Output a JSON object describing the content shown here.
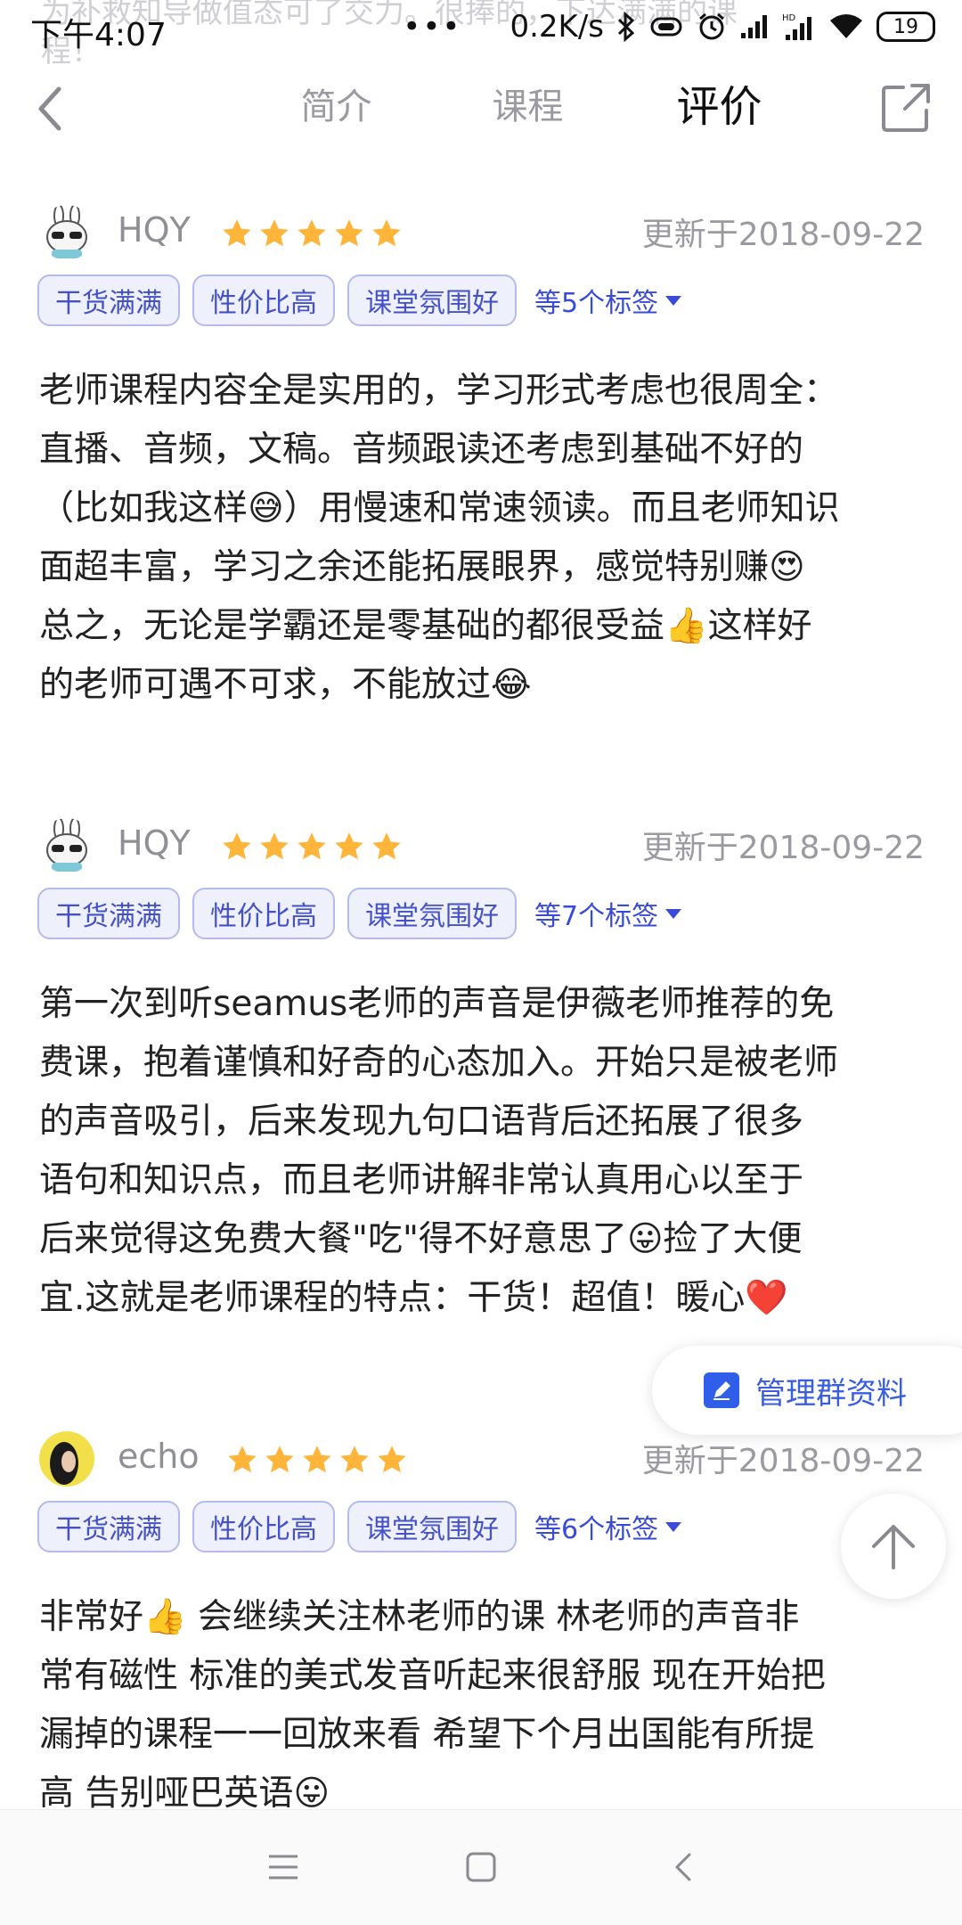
{
  "status_bar": {
    "ghost_line1": "为补救知导做值态可了交力。很捧的，下达满满的课",
    "ghost_line2": "程！",
    "time": "下午4:07",
    "dots": "•••",
    "speed": "0.2K/s",
    "battery": "19"
  },
  "nav": {
    "tabs": [
      {
        "label": "简介"
      },
      {
        "label": "课程"
      },
      {
        "label": "评价"
      }
    ],
    "active_tab": "评价"
  },
  "reviews": [
    {
      "username": "HQY",
      "rating": 5,
      "date": "更新于2018-09-22",
      "tags": [
        "干货满满",
        "性价比高",
        "课堂氛围好"
      ],
      "more_tags": "等5个标签",
      "lines": [
        "老师课程内容全是实用的，学习形式考虑也很周全：",
        "直播、音频，文稿。音频跟读还考虑到基础不好的",
        "（比如我这样😅）用慢速和常速领读。而且老师知识",
        "面超丰富，学习之余还能拓展眼界，感觉特别赚😍",
        "总之，无论是学霸还是零基础的都很受益👍这样好",
        "的老师可遇不可求，不能放过😂"
      ]
    },
    {
      "username": "HQY",
      "rating": 5,
      "date": "更新于2018-09-22",
      "tags": [
        "干货满满",
        "性价比高",
        "课堂氛围好"
      ],
      "more_tags": "等7个标签",
      "lines": [
        "第一次到听seamus老师的声音是伊薇老师推荐的免",
        "费课，抱着谨慎和好奇的心态加入。开始只是被老师",
        "的声音吸引，后来发现九句口语背后还拓展了很多",
        "语句和知识点，而且老师讲解非常认真用心以至于",
        "后来觉得这免费大餐\"吃\"得不好意思了😛捡了大便",
        "宜.这就是老师课程的特点：干货！超值！暖心❤️"
      ]
    },
    {
      "username": "echo",
      "rating": 5,
      "date": "更新于2018-09-22",
      "tags": [
        "干货满满",
        "性价比高",
        "课堂氛围好"
      ],
      "more_tags": "等6个标签",
      "lines": [
        "非常好👍 会继续关注林老师的课 林老师的声音非",
        "常有磁性 标准的美式发音听起来很舒服 现在开始把",
        "漏掉的课程一一回放来看 希望下个月出国能有所提",
        "高 告别哑巴英语😛"
      ]
    }
  ],
  "floating": {
    "manage_label": "管理群资料"
  },
  "colors": {
    "accent": "#3a4bd8",
    "star": "#ffb53a",
    "tag_bg": "#eef0fb",
    "tag_border": "#b5bbea"
  }
}
